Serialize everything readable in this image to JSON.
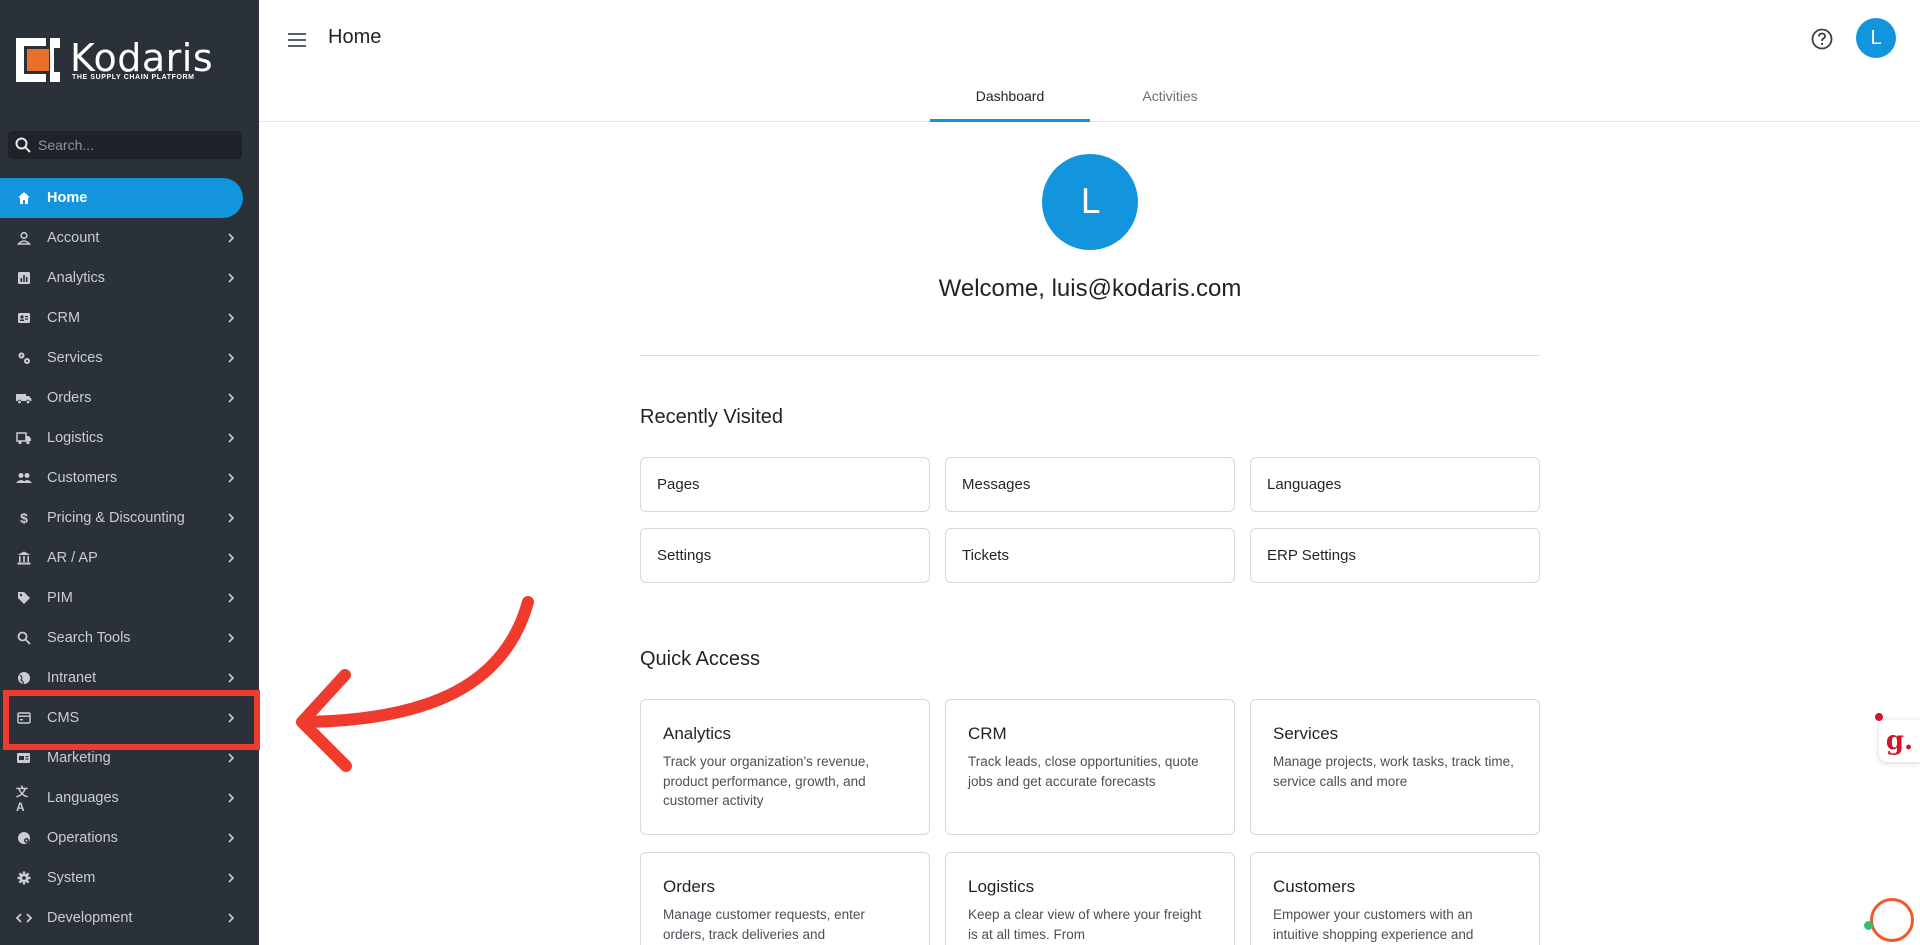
{
  "app": {
    "brand_name": "Kodaris",
    "brand_tagline": "THE SUPPLY CHAIN PLATFORM",
    "accent_color": "#1295dc",
    "annotation_color": "#ef3b2d"
  },
  "sidebar": {
    "search_placeholder": "Search...",
    "items": [
      {
        "label": "Home",
        "icon": "home-icon",
        "active": true
      },
      {
        "label": "Account",
        "icon": "account-icon"
      },
      {
        "label": "Analytics",
        "icon": "analytics-icon"
      },
      {
        "label": "CRM",
        "icon": "crm-icon"
      },
      {
        "label": "Services",
        "icon": "services-icon"
      },
      {
        "label": "Orders",
        "icon": "truck-icon"
      },
      {
        "label": "Logistics",
        "icon": "logistics-icon"
      },
      {
        "label": "Customers",
        "icon": "customers-icon"
      },
      {
        "label": "Pricing & Discounting",
        "icon": "dollar-icon"
      },
      {
        "label": "AR / AP",
        "icon": "bank-icon"
      },
      {
        "label": "PIM",
        "icon": "tag-icon"
      },
      {
        "label": "Search Tools",
        "icon": "search-icon"
      },
      {
        "label": "Intranet",
        "icon": "globe-icon"
      },
      {
        "label": "CMS",
        "icon": "cms-icon",
        "highlighted": true
      },
      {
        "label": "Marketing",
        "icon": "marketing-icon"
      },
      {
        "label": "Languages",
        "icon": "translate-icon"
      },
      {
        "label": "Operations",
        "icon": "operations-icon"
      },
      {
        "label": "System",
        "icon": "gear-icon"
      },
      {
        "label": "Development",
        "icon": "code-icon"
      }
    ]
  },
  "header": {
    "title": "Home",
    "user_initial": "L",
    "tabs": [
      {
        "label": "Dashboard",
        "active": true
      },
      {
        "label": "Activities",
        "active": false
      }
    ]
  },
  "main": {
    "avatar_initial": "L",
    "welcome": "Welcome, luis@kodaris.com",
    "recently_visited": {
      "title": "Recently Visited",
      "items": [
        "Pages",
        "Messages",
        "Languages",
        "Settings",
        "Tickets",
        "ERP Settings"
      ]
    },
    "quick_access": {
      "title": "Quick Access",
      "items": [
        {
          "title": "Analytics",
          "desc": "Track your organization's revenue, product performance, growth, and customer activity"
        },
        {
          "title": "CRM",
          "desc": "Track leads, close opportunities, quote jobs and get accurate forecasts"
        },
        {
          "title": "Services",
          "desc": "Manage projects, work tasks, track time, service calls and more"
        },
        {
          "title": "Orders",
          "desc": "Manage customer requests, enter orders, track deliveries and"
        },
        {
          "title": "Logistics",
          "desc": "Keep a clear view of where your freight is at all times. From"
        },
        {
          "title": "Customers",
          "desc": "Empower your customers with an intuitive shopping experience and"
        }
      ]
    }
  },
  "widgets": {
    "grammarly_letter": "g."
  }
}
